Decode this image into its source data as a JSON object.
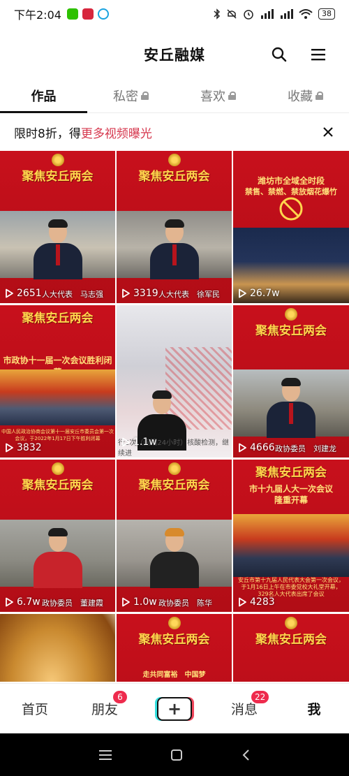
{
  "status_bar": {
    "time": "下午2:04",
    "battery": "38",
    "app_icons": [
      "wechat-icon",
      "app-red-icon",
      "app-blue-icon"
    ],
    "system_icons": [
      "bluetooth-icon",
      "mute-icon",
      "alarm-icon",
      "signal-hd-icon",
      "signal-hd-icon",
      "wifi-icon",
      "battery-icon"
    ]
  },
  "header": {
    "title": "安丘融媒",
    "search_icon": "search-icon",
    "menu_icon": "menu-icon"
  },
  "tabs": [
    {
      "label": "作品",
      "active": true,
      "locked": false
    },
    {
      "label": "私密",
      "active": false,
      "locked": true
    },
    {
      "label": "喜欢",
      "active": false,
      "locked": true
    },
    {
      "label": "收藏",
      "active": false,
      "locked": true
    }
  ],
  "promo": {
    "prefix": "限时8折，得",
    "link": "更多视频曝光",
    "close_icon": "close-icon"
  },
  "videos": [
    {
      "views": "2651",
      "banner": "聚焦安丘两会",
      "caption": "人大代表　马志强"
    },
    {
      "views": "3319",
      "banner": "聚焦安丘两会",
      "caption": "人大代表　徐军民"
    },
    {
      "views": "26.7w",
      "headline": "潍坊市全域全时段",
      "subline": "禁售、禁燃、禁放烟花爆竹"
    },
    {
      "views": "3832",
      "banner": "聚焦安丘两会",
      "headline": "市政协十一届一次会议胜利闭幕",
      "subline": "中国人民政治协商会议第十一届安丘市委员会第一次会议，于2022年1月17日下午胜利闭幕"
    },
    {
      "views": "1.1w",
      "caption": "行2次（间隔24小时）核酸检测，继续进"
    },
    {
      "views": "4666",
      "banner": "聚焦安丘两会",
      "caption": "政协委员　刘建龙"
    },
    {
      "views": "6.7w",
      "banner": "聚焦安丘两会",
      "caption": "政协委员　董建霞"
    },
    {
      "views": "1.0w",
      "banner": "聚焦安丘两会",
      "caption": "政协委员　陈华"
    },
    {
      "views": "4283",
      "banner": "聚焦安丘两会",
      "headline": "市十九届人大一次会议隆重开幕",
      "subline": "安丘市第十九届人民代表大会第一次会议，于1月16日上午在市委党校大礼堂开幕，329名人大代表出席了会议"
    },
    {
      "views": "",
      "caption": ""
    },
    {
      "views": "",
      "banner": "聚焦安丘两会",
      "subline": "走共同富裕　中国梦"
    },
    {
      "views": "",
      "banner": "聚焦安丘两会"
    }
  ],
  "bottom_nav": [
    {
      "label": "首页",
      "badge": ""
    },
    {
      "label": "朋友",
      "badge": "6"
    },
    {
      "label": "+",
      "badge": ""
    },
    {
      "label": "消息",
      "badge": "22"
    },
    {
      "label": "我",
      "badge": ""
    }
  ],
  "system_nav": [
    "menu-icon",
    "home-icon",
    "back-icon"
  ]
}
